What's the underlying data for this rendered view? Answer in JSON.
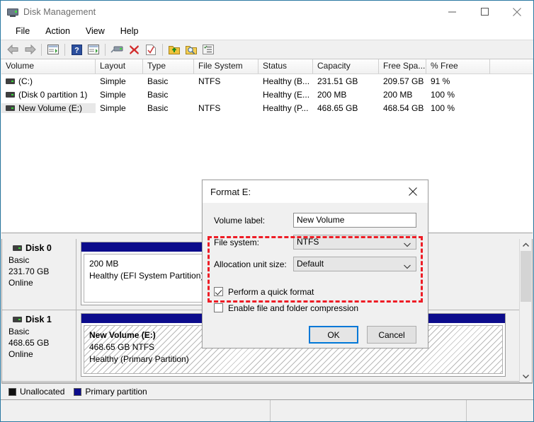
{
  "window": {
    "title": "Disk Management",
    "icon": "disk-management-icon",
    "controls": {
      "minimize": "minimize-icon",
      "maximize": "maximize-icon",
      "close": "close-icon"
    }
  },
  "menu": {
    "items": [
      "File",
      "Action",
      "View",
      "Help"
    ]
  },
  "toolbar": {
    "buttons": [
      "back-arrow-icon",
      "forward-arrow-icon",
      "separator",
      "show-hide-console-tree-icon",
      "separator",
      "help-icon",
      "properties-icon",
      "separator",
      "rescan-disks-icon",
      "delete-icon",
      "check-icon",
      "separator",
      "export-icon",
      "search-icon",
      "list-view-icon"
    ]
  },
  "volume_list": {
    "columns": [
      "Volume",
      "Layout",
      "Type",
      "File System",
      "Status",
      "Capacity",
      "Free Spa...",
      "% Free"
    ],
    "rows": [
      {
        "volume": "(C:)",
        "layout": "Simple",
        "type": "Basic",
        "file_system": "NTFS",
        "status": "Healthy (B...",
        "capacity": "231.51 GB",
        "free_space": "209.57 GB",
        "percent_free": "91 %",
        "selected": false
      },
      {
        "volume": "(Disk 0 partition 1)",
        "layout": "Simple",
        "type": "Basic",
        "file_system": "",
        "status": "Healthy (E...",
        "capacity": "200 MB",
        "free_space": "200 MB",
        "percent_free": "100 %",
        "selected": false
      },
      {
        "volume": "New Volume (E:)",
        "layout": "Simple",
        "type": "Basic",
        "file_system": "NTFS",
        "status": "Healthy (P...",
        "capacity": "468.65 GB",
        "free_space": "468.54 GB",
        "percent_free": "100 %",
        "selected": true
      }
    ]
  },
  "graphical_view": {
    "disks": [
      {
        "name": "Disk 0",
        "type": "Basic",
        "capacity": "231.70 GB",
        "state": "Online",
        "partitions": [
          {
            "title": "",
            "size": "200 MB",
            "status": "Healthy (EFI System Partition)",
            "hatched": false
          }
        ]
      },
      {
        "name": "Disk 1",
        "type": "Basic",
        "capacity": "468.65 GB",
        "state": "Online",
        "partitions": [
          {
            "title": "New Volume  (E:)",
            "size": "468.65 GB NTFS",
            "status": "Healthy (Primary Partition)",
            "hatched": true
          }
        ]
      }
    ]
  },
  "legend": {
    "items": [
      {
        "label": "Unallocated",
        "color": "#101010"
      },
      {
        "label": "Primary partition",
        "color": "#0c0c8c"
      }
    ]
  },
  "dialog": {
    "title": "Format E:",
    "close_icon": "close-icon",
    "fields": {
      "volume_label": {
        "label": "Volume label:",
        "value": "New Volume",
        "placeholder": ""
      },
      "file_system": {
        "label": "File system:",
        "value": "NTFS"
      },
      "allocation_unit_size": {
        "label": "Allocation unit size:",
        "value": "Default"
      }
    },
    "checkboxes": [
      {
        "label": "Perform a quick format",
        "checked": true
      },
      {
        "label": "Enable file and folder compression",
        "checked": false
      }
    ],
    "buttons": {
      "ok": "OK",
      "cancel": "Cancel"
    },
    "highlight_color": "#ee1c25",
    "accent_color": "#0078d7"
  }
}
